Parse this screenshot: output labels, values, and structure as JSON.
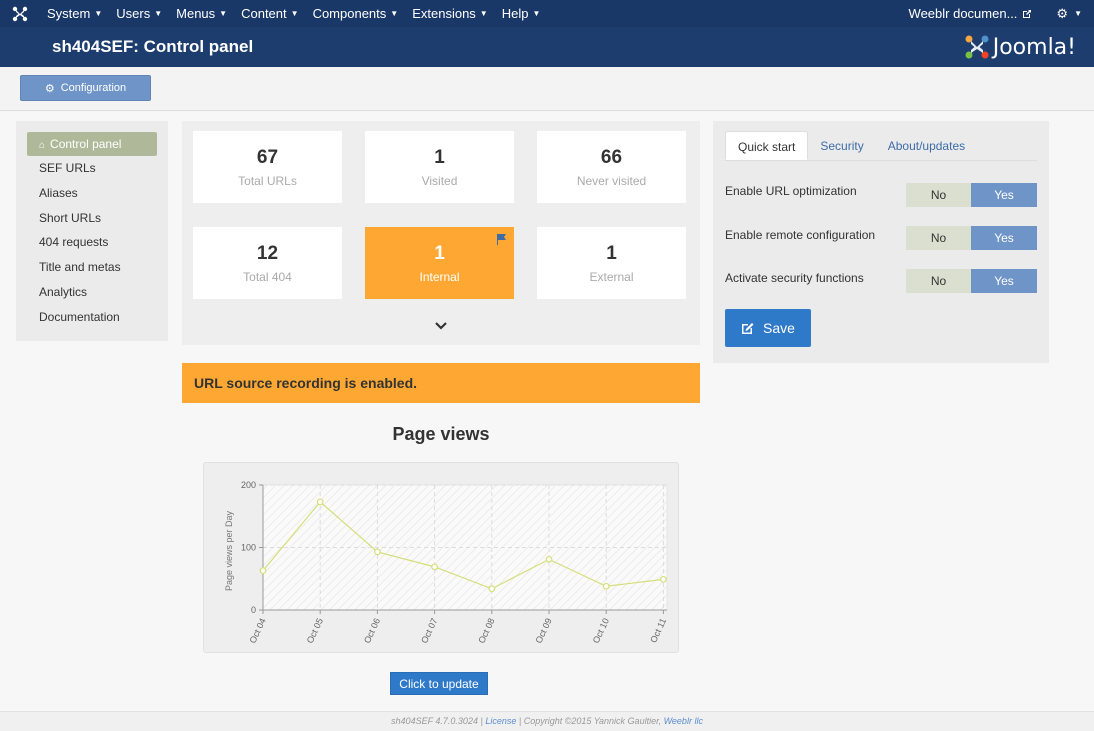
{
  "topnav": {
    "menus": [
      "System",
      "Users",
      "Menus",
      "Content",
      "Components",
      "Extensions",
      "Help"
    ],
    "site_name": "Weeblr documen...",
    "icons": {
      "joomla": "joomla-logo-icon",
      "external": "external-link-icon",
      "gear": "gear-icon"
    }
  },
  "header": {
    "title": "sh404SEF: Control panel",
    "brand": "Joomla!"
  },
  "toolbar": {
    "config_label": "Configuration"
  },
  "sidebar": {
    "items": [
      {
        "label": "Control panel",
        "active": true
      },
      {
        "label": "SEF URLs"
      },
      {
        "label": "Aliases"
      },
      {
        "label": "Short URLs"
      },
      {
        "label": "404 requests"
      },
      {
        "label": "Title and metas"
      },
      {
        "label": "Analytics"
      },
      {
        "label": "Documentation"
      }
    ]
  },
  "stats": [
    {
      "num": "67",
      "label": "Total URLs"
    },
    {
      "num": "1",
      "label": "Visited"
    },
    {
      "num": "66",
      "label": "Never visited"
    },
    {
      "num": "12",
      "label": "Total 404"
    },
    {
      "num": "1",
      "label": "Internal",
      "highlight": true
    },
    {
      "num": "1",
      "label": "External"
    }
  ],
  "alert": {
    "text": "URL source recording is enabled."
  },
  "chart_data": {
    "type": "line",
    "title": "Page views",
    "ylabel": "Page views per Day",
    "xlabel": "",
    "categories": [
      "Oct 04",
      "Oct 05",
      "Oct 06",
      "Oct 07",
      "Oct 08",
      "Oct 09",
      "Oct 10",
      "Oct 11"
    ],
    "values": [
      63,
      173,
      93,
      69,
      34,
      81,
      38,
      49
    ],
    "ylim": [
      0,
      200
    ],
    "yticks": [
      0,
      100,
      200
    ],
    "grid": true,
    "color": "#d4df79"
  },
  "update_label": "Click to update",
  "right": {
    "tabs": [
      "Quick start",
      "Security",
      "About/updates"
    ],
    "settings": [
      {
        "label": "Enable URL optimization",
        "no": "No",
        "yes": "Yes"
      },
      {
        "label": "Enable remote configuration",
        "no": "No",
        "yes": "Yes"
      },
      {
        "label": "Activate security functions",
        "no": "No",
        "yes": "Yes"
      }
    ],
    "save_label": "Save"
  },
  "footer": {
    "prefix": "sh404SEF 4.7.0.3024 |",
    "license": "License",
    "mid": "| Copyright ©2015 Yannick Gaultier,",
    "company": "Weeblr llc"
  },
  "colors": {
    "nav": "#1a3867",
    "header": "#1c3d6e",
    "accent": "#fea833",
    "primary": "#2f79c9",
    "toggle_yes": "#6f94c7",
    "line": "#d4df79"
  }
}
